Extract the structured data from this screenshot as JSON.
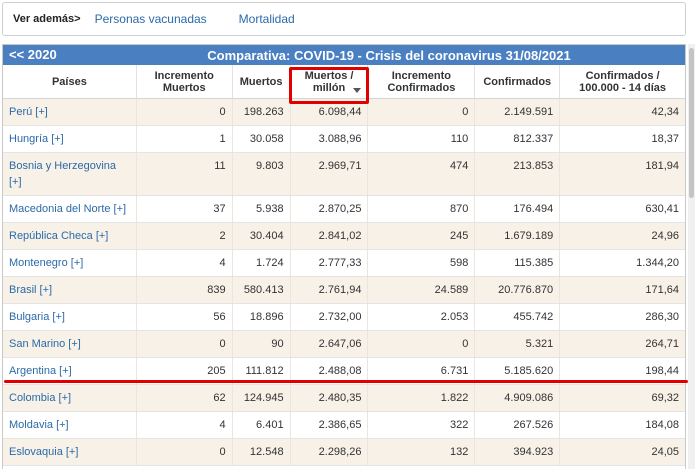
{
  "nav": {
    "label": "Ver además>",
    "links": [
      "Personas vacunadas",
      "Mortalidad"
    ]
  },
  "table": {
    "prev_link": "<<  2020",
    "title": "Comparativa: COVID-19 - Crisis del coronavirus 31/08/2021",
    "headers": [
      "Países",
      "Incremento\nMuertos",
      "Muertos",
      "Muertos /\nmillón",
      "Incremento\nConfirmados",
      "Confirmados",
      "Confirmados /\n100.000 - 14 días"
    ],
    "rows": [
      [
        "Perú [+]",
        "0",
        "198.263",
        "6.098,44",
        "0",
        "2.149.591",
        "42,34"
      ],
      [
        "Hungría [+]",
        "1",
        "30.058",
        "3.088,96",
        "110",
        "812.337",
        "18,37"
      ],
      [
        "Bosnia y Herzegovina [+]",
        "11",
        "9.803",
        "2.969,71",
        "474",
        "213.853",
        "181,94"
      ],
      [
        "Macedonia del Norte [+]",
        "37",
        "5.938",
        "2.870,25",
        "870",
        "176.494",
        "630,41"
      ],
      [
        "República Checa [+]",
        "2",
        "30.404",
        "2.841,02",
        "245",
        "1.679.189",
        "24,96"
      ],
      [
        "Montenegro [+]",
        "4",
        "1.724",
        "2.777,33",
        "598",
        "115.385",
        "1.344,20"
      ],
      [
        "Brasil [+]",
        "839",
        "580.413",
        "2.761,94",
        "24.589",
        "20.776.870",
        "171,64"
      ],
      [
        "Bulgaria [+]",
        "56",
        "18.896",
        "2.732,00",
        "2.053",
        "455.742",
        "286,30"
      ],
      [
        "San Marino [+]",
        "0",
        "90",
        "2.647,06",
        "0",
        "5.321",
        "264,71"
      ],
      [
        "Argentina [+]",
        "205",
        "111.812",
        "2.488,08",
        "6.731",
        "5.185.620",
        "198,44"
      ],
      [
        "Colombia [+]",
        "62",
        "124.945",
        "2.480,35",
        "1.822",
        "4.909.086",
        "69,32"
      ],
      [
        "Moldavia [+]",
        "4",
        "6.401",
        "2.386,65",
        "322",
        "267.526",
        "184,08"
      ],
      [
        "Eslovaquia [+]",
        "0",
        "12.548",
        "2.298,26",
        "132",
        "394.923",
        "24,05"
      ]
    ]
  },
  "colors": {
    "accent": "#4a7fc1",
    "link": "#2b6aa8",
    "highlight": "#e00000",
    "row_alt": "#f7f1e8"
  },
  "icons": {
    "sort": "sort-desc-icon"
  }
}
